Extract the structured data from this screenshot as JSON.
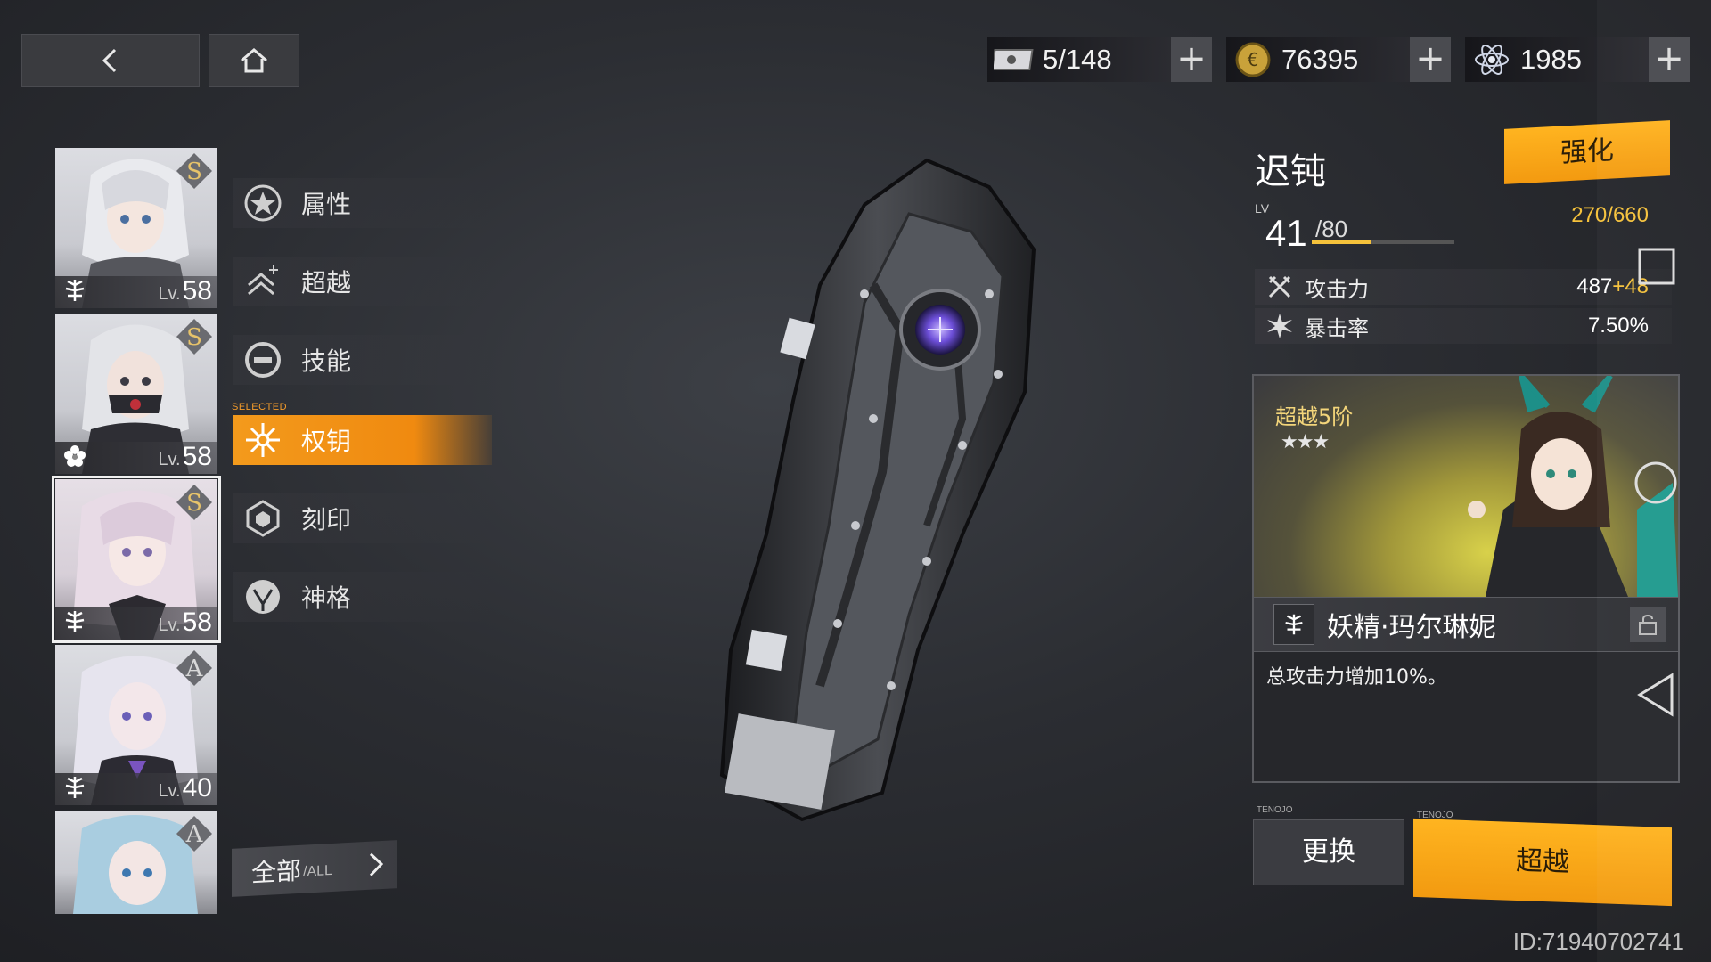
{
  "nav": {
    "back_icon": "chevron-left-icon",
    "home_icon": "home-icon"
  },
  "currencies": [
    {
      "icon": "ticket-icon",
      "value": "5/148",
      "add": "+"
    },
    {
      "icon": "coin-icon",
      "value": "76395",
      "add": "+"
    },
    {
      "icon": "crystal-icon",
      "value": "1985",
      "add": "+"
    }
  ],
  "characters": [
    {
      "rank": "S",
      "level_prefix": "Lv.",
      "level": "58",
      "element": "leaf-icon"
    },
    {
      "rank": "S",
      "level_prefix": "Lv.",
      "level": "58",
      "element": "flower-icon"
    },
    {
      "rank": "S",
      "level_prefix": "Lv.",
      "level": "58",
      "element": "leaf-icon",
      "selected": true
    },
    {
      "rank": "A",
      "level_prefix": "Lv.",
      "level": "40",
      "element": "leaf-icon"
    },
    {
      "rank": "A",
      "level_prefix": "",
      "level": "",
      "element": ""
    }
  ],
  "menu": {
    "selected_tag": "SELECTED",
    "items": [
      {
        "label": "属性",
        "icon": "star-icon"
      },
      {
        "label": "超越",
        "icon": "ascend-icon"
      },
      {
        "label": "技能",
        "icon": "skill-icon"
      },
      {
        "label": "权钥",
        "icon": "key-icon",
        "active": true
      },
      {
        "label": "刻印",
        "icon": "imprint-icon"
      },
      {
        "label": "神格",
        "icon": "divinity-icon"
      }
    ],
    "all_label": "全部",
    "all_sub": "/ALL"
  },
  "weapon": {
    "name": "迟钝",
    "enhance_label": "强化",
    "lv_tag": "LV",
    "level": "41",
    "max_level": "/80",
    "xp_text": "270/660",
    "xp_fraction": 0.41,
    "stats": [
      {
        "label": "攻击力",
        "value": "487",
        "bonus": "+48",
        "icon": "swords-icon"
      },
      {
        "label": "暴击率",
        "value": "7.50%",
        "bonus": "",
        "icon": "burst-icon"
      }
    ]
  },
  "transcend": {
    "tier": "超越5阶",
    "stars": "★★★",
    "character_name": "妖精·玛尔琳妮",
    "description": "总攻击力增加10%。"
  },
  "buttons": {
    "swap": "更换",
    "swap_caption": "TENOJO",
    "transcend": "超越",
    "transcend_caption": "TENOJO"
  },
  "player_id": "ID:71940702741",
  "colors": {
    "accent": "#f39a1c",
    "xp": "#f5c23b",
    "bg": "#2b2d32"
  }
}
